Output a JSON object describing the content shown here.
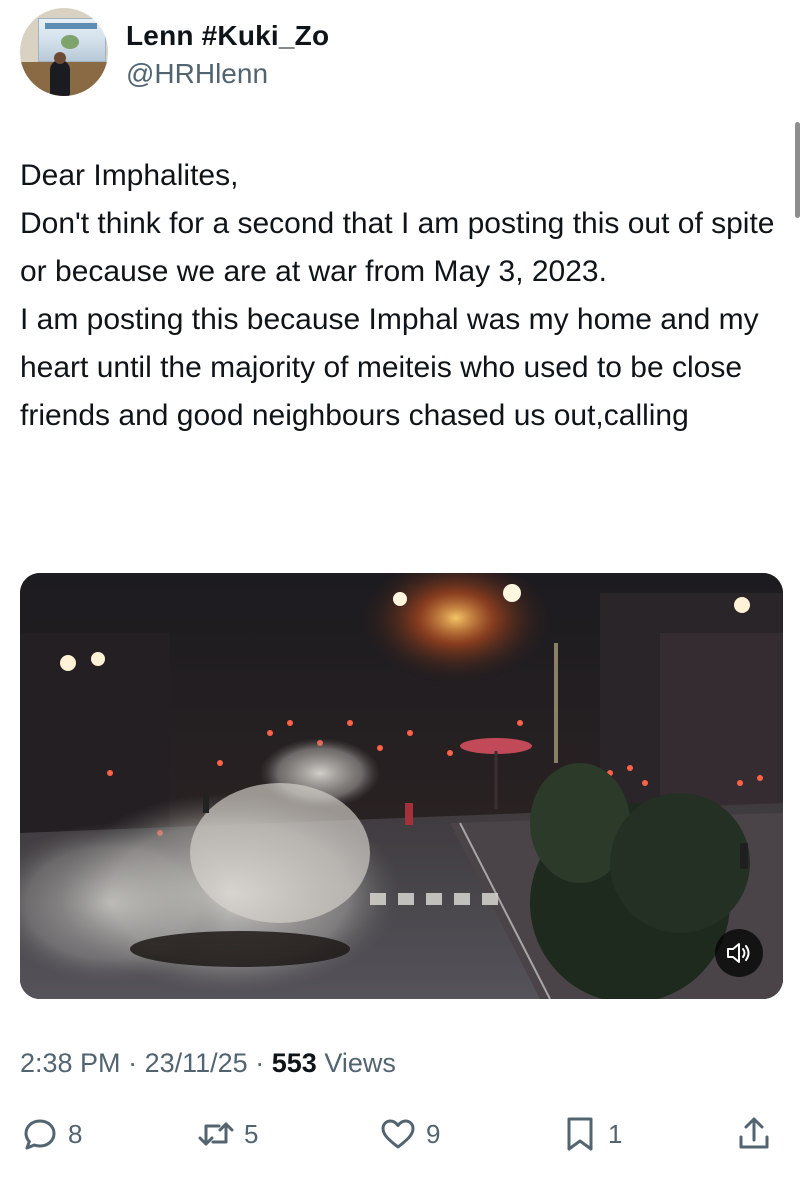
{
  "tweet": {
    "author": {
      "name": "Lenn #Kuki_Zo",
      "handle": "@HRHlenn"
    },
    "text": "Dear Imphalites,\nDon't think for a second that I am posting this out of spite or because we are at war from May 3, 2023.\nI am posting this because Imphal was my home and my heart until the majority of meiteis who used to be close friends and good neighbours chased us out,calling",
    "time": "2:38 PM",
    "separator": "·",
    "date": "23/11/25",
    "views_count": "553",
    "views_label": "Views"
  },
  "media": {
    "type": "video",
    "audio_icon": "speaker-icon"
  },
  "actions": {
    "replies": "8",
    "reposts": "5",
    "likes": "9",
    "bookmarks": "1"
  },
  "colors": {
    "text": "#0f1419",
    "secondary": "#536471",
    "background": "#ffffff"
  }
}
